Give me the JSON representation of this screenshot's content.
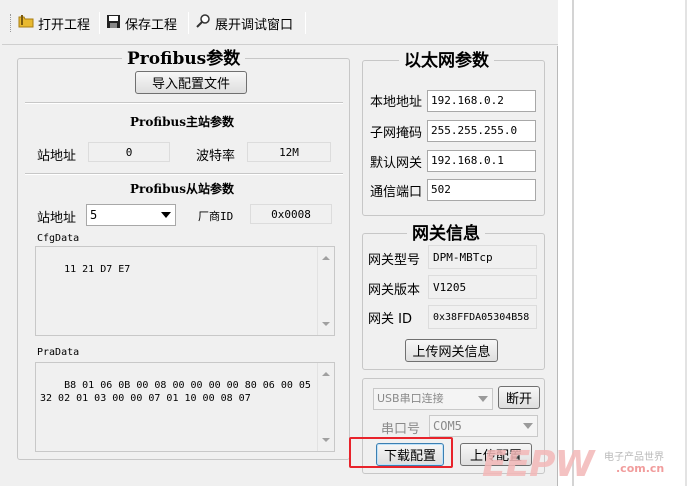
{
  "toolbar": {
    "open_label": "打开工程",
    "save_label": "保存工程",
    "debug_label": "展开调试窗口"
  },
  "profibus": {
    "title": "Profibus参数",
    "import_button": "导入配置文件",
    "master_title": "Profibus主站参数",
    "master_station_label": "站地址",
    "master_station_value": "0",
    "baud_label": "波特率",
    "baud_value": "12M",
    "slave_title": "Profibus从站参数",
    "slave_station_label": "站地址",
    "slave_station_value": "5",
    "vendor_label": "厂商ID",
    "vendor_value": "0x0008",
    "cfg_label": "CfgData",
    "cfg_value": "11 21 D7 E7",
    "pra_label": "PraData",
    "pra_value": "B8 01 06 0B 00 08 00 00 00 00 80 06 00 05\n32 02 01 03 00 00 07 01 10 00 08 07"
  },
  "ethernet": {
    "title": "以太网参数",
    "local_ip_label": "本地地址",
    "local_ip_value": "192.168.0.2",
    "mask_label": "子网掩码",
    "mask_value": "255.255.255.0",
    "gateway_label": "默认网关",
    "gateway_value": "192.168.0.1",
    "port_label": "通信端口",
    "port_value": "502"
  },
  "gateway_info": {
    "title": "网关信息",
    "model_label": "网关型号",
    "model_value": "DPM-MBTcp",
    "version_label": "网关版本",
    "version_value": "V1205",
    "id_label": "网关 ID",
    "id_value": "0x38FFDA05304B58",
    "upload_button": "上传网关信息"
  },
  "connection": {
    "mode_value": "USB串口连接",
    "disconnect_button": "断开",
    "port_label": "串口号",
    "port_value": "COM5",
    "download_button": "下载配置",
    "upload_button": "上传配置"
  },
  "watermark": {
    "logo": "EEPW",
    "cn": "电子产品世界",
    "url": ".com.cn"
  },
  "colors": {
    "highlight": "#e8232b",
    "window_bg": "#f0f0f0"
  }
}
